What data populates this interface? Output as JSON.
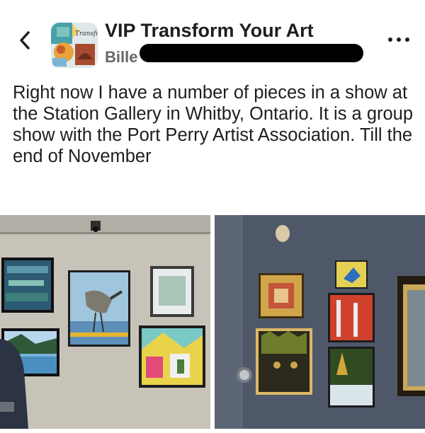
{
  "header": {
    "group_name": "VIP Transform Your Art",
    "author_visible": "Bille",
    "avatar_caption": "Transform"
  },
  "post": {
    "text": "Right now I have a number of pieces in a show at the Station Gallery in Whitby, Ontario. It is a group show with the Port Perry Artist Association. Till the end of November"
  },
  "photos": [
    {
      "name": "gallery-photo-left"
    },
    {
      "name": "gallery-photo-right"
    }
  ],
  "icons": {
    "back": "chevron-left-icon",
    "more": "more-horizontal-icon"
  }
}
